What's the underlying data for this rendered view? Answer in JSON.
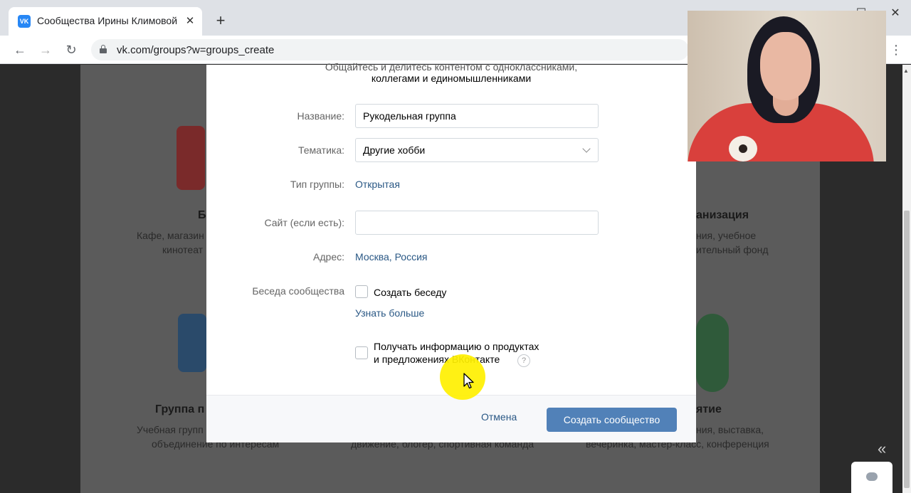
{
  "browser": {
    "tab_title": "Сообщества Ирины Климовой",
    "favicon_text": "VK",
    "url": "vk.com/groups?w=groups_create",
    "icons": [
      "vk-favicon",
      "close-icon",
      "plus-icon",
      "back-icon",
      "forward-icon",
      "reload-icon",
      "lock-icon",
      "kebab-menu-icon",
      "minimize-icon",
      "maximize-icon",
      "close-window-icon"
    ]
  },
  "background": {
    "cards": [
      {
        "title": "Б",
        "text1": "Кафе, магазин",
        "text2": "кинотеат"
      },
      {
        "title": "анизация",
        "text1": "ния, учебное",
        "text2": "ительный фонд"
      },
      {
        "title": "Группа п",
        "text1": "Учебная групп",
        "text2": "объединение по интересам"
      },
      {
        "title": "ятие",
        "text1": "ния, выставка,",
        "text2": "вечеринка, мастер-класс, конференция"
      },
      {
        "title": "",
        "text1": "",
        "text2": "движение, блогер, спортивная команда"
      }
    ]
  },
  "modal": {
    "subtitle_line1": "Общайтесь и делитесь контентом с одноклассниками,",
    "subtitle_line2": "коллегами и единомышленниками",
    "name_label": "Название:",
    "name_value": "Рукодельная группа",
    "topic_label": "Тематика:",
    "topic_value": "Другие хобби",
    "type_label": "Тип группы:",
    "type_value": "Открытая",
    "site_label": "Сайт (если есть):",
    "site_value": "",
    "address_label": "Адрес:",
    "address_value": "Москва, Россия",
    "chat_label": "Беседа сообщества",
    "chat_checkbox": "Создать беседу",
    "learn_more": "Узнать больше",
    "promo_line1": "Получать информацию о продуктах",
    "promo_line2": "и предложениях ВКонтакте",
    "help": "?",
    "cancel": "Отмена",
    "create": "Создать сообщество"
  },
  "colors": {
    "accent": "#5181b8",
    "link": "#2a5885",
    "cursor_highlight": "#fff000"
  }
}
